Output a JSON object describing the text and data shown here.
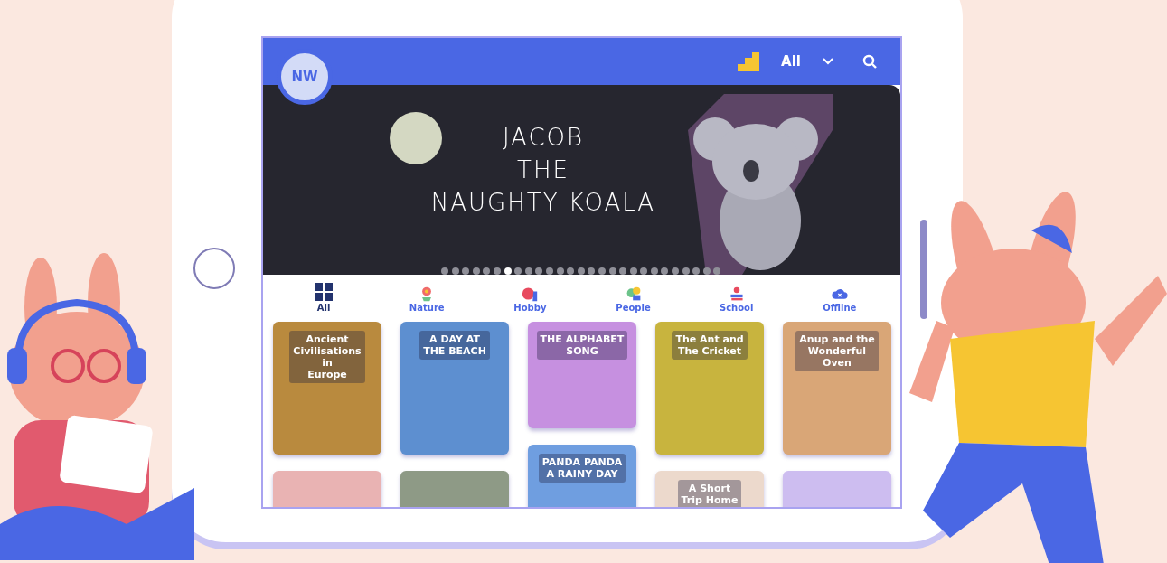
{
  "header": {
    "avatar_initials": "NW",
    "filter_label": "All"
  },
  "banner": {
    "title_lines": [
      "JACOB",
      "THE",
      "NAUGHTY KOALA"
    ],
    "slides": [
      {
        "selected": false
      },
      {
        "selected": false
      },
      {
        "selected": false
      },
      {
        "selected": false
      },
      {
        "selected": false
      },
      {
        "selected": false
      },
      {
        "selected": true
      },
      {
        "selected": false
      },
      {
        "selected": false
      },
      {
        "selected": false
      },
      {
        "selected": false
      },
      {
        "selected": false
      },
      {
        "selected": false
      },
      {
        "selected": false
      },
      {
        "selected": false
      },
      {
        "selected": false
      },
      {
        "selected": false
      },
      {
        "selected": false
      },
      {
        "selected": false
      },
      {
        "selected": false
      },
      {
        "selected": false
      },
      {
        "selected": false
      },
      {
        "selected": false
      },
      {
        "selected": false
      },
      {
        "selected": false
      },
      {
        "selected": false
      },
      {
        "selected": false
      }
    ]
  },
  "categories": [
    {
      "label": "All",
      "kind": "grid",
      "selected": true
    },
    {
      "label": "Nature",
      "kind": "flower",
      "selected": false
    },
    {
      "label": "Hobby",
      "kind": "ball",
      "selected": false
    },
    {
      "label": "People",
      "kind": "people",
      "selected": false
    },
    {
      "label": "School",
      "kind": "books",
      "selected": false
    },
    {
      "label": "Offline",
      "kind": "cloud",
      "selected": false
    }
  ],
  "book_columns": [
    [
      {
        "kind": "tall",
        "color": "#b98a3e",
        "title_lines": [
          "Ancient",
          "Civilisations",
          "in",
          "Europe"
        ]
      },
      {
        "kind": "tall",
        "color": "#e9b3b3"
      }
    ],
    [
      {
        "kind": "tall",
        "color": "#5d8fd0",
        "title_lines": [
          "A DAY AT",
          "THE BEACH"
        ]
      },
      {
        "kind": "tall",
        "color": "#8e9a86"
      }
    ],
    [
      {
        "kind": "short",
        "color": "#c690e0",
        "title_lines": [
          "THE ALPHABET",
          "SONG"
        ]
      },
      {
        "kind": "tall",
        "color": "#6f9ee0",
        "title_lines": [
          "PANDA PANDA",
          "A RAINY DAY"
        ]
      }
    ],
    [
      {
        "kind": "tall",
        "color": "#c8b43e",
        "title_lines": [
          "The Ant and",
          "The Cricket"
        ]
      },
      {
        "kind": "tall",
        "color": "#ecd9cc",
        "title_lines": [
          "A Short",
          "Trip Home"
        ]
      }
    ],
    [
      {
        "kind": "tall",
        "color": "#d9a677",
        "title_lines": [
          "Anup and the",
          "Wonderful",
          "Oven"
        ]
      },
      {
        "kind": "tall",
        "color": "#cdbdf0"
      }
    ]
  ]
}
